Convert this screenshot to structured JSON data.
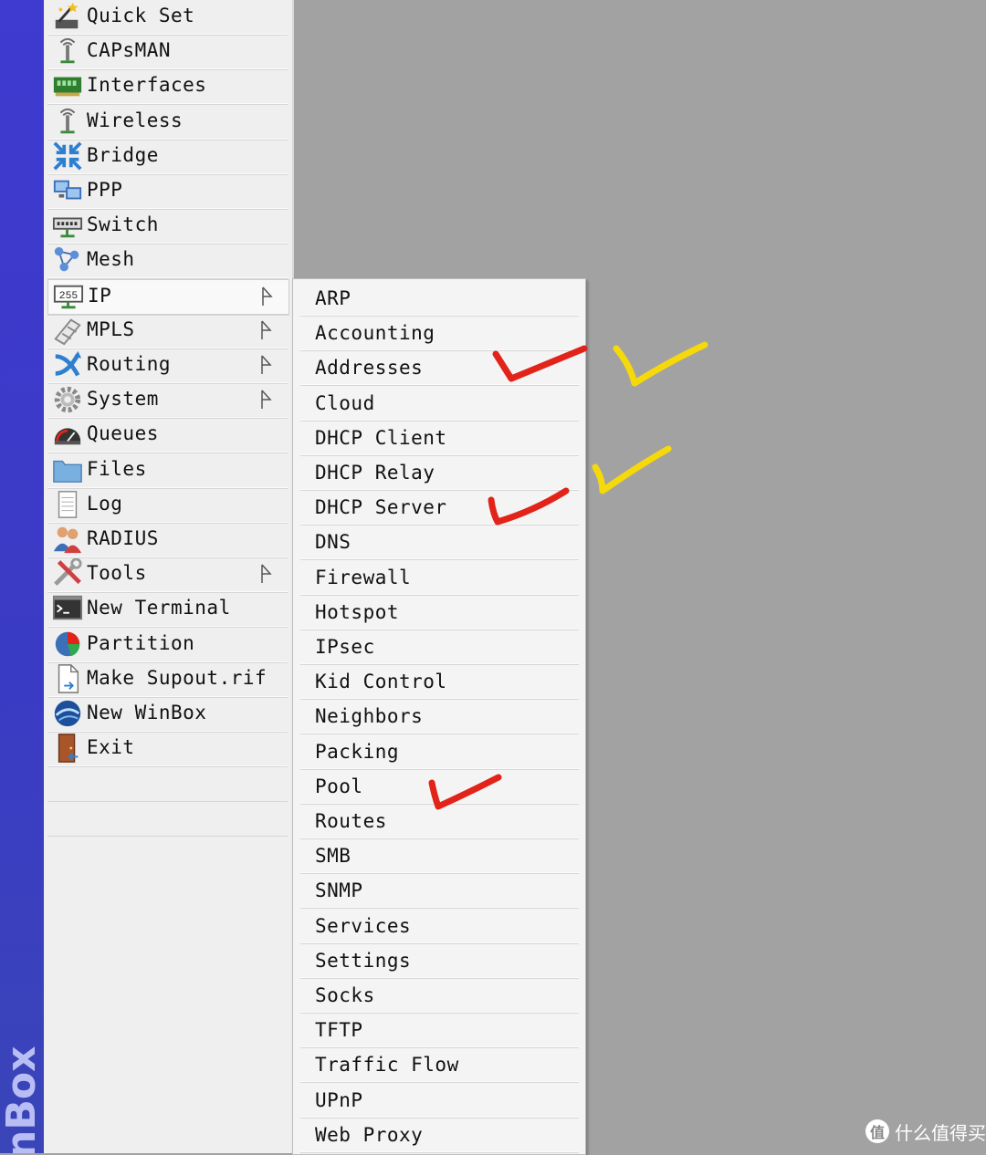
{
  "brand": {
    "text": "nBox",
    "color": "#3f3ad0"
  },
  "main_menu": {
    "items": [
      {
        "label": "Quick Set",
        "icon": "wand-icon",
        "has_submenu": false
      },
      {
        "label": "CAPsMAN",
        "icon": "antenna-icon",
        "has_submenu": false
      },
      {
        "label": "Interfaces",
        "icon": "network-card-icon",
        "has_submenu": false
      },
      {
        "label": "Wireless",
        "icon": "antenna-icon",
        "has_submenu": false
      },
      {
        "label": "Bridge",
        "icon": "bridge-icon",
        "has_submenu": false
      },
      {
        "label": "PPP",
        "icon": "computers-icon",
        "has_submenu": false
      },
      {
        "label": "Switch",
        "icon": "switch-icon",
        "has_submenu": false
      },
      {
        "label": "Mesh",
        "icon": "mesh-icon",
        "has_submenu": false
      },
      {
        "label": "IP",
        "icon": "ip-255-icon",
        "has_submenu": true,
        "active": true
      },
      {
        "label": "MPLS",
        "icon": "mpls-icon",
        "has_submenu": true
      },
      {
        "label": "Routing",
        "icon": "routing-icon",
        "has_submenu": true
      },
      {
        "label": "System",
        "icon": "gear-icon",
        "has_submenu": true
      },
      {
        "label": "Queues",
        "icon": "gauge-icon",
        "has_submenu": false
      },
      {
        "label": "Files",
        "icon": "folder-icon",
        "has_submenu": false
      },
      {
        "label": "Log",
        "icon": "notepad-icon",
        "has_submenu": false
      },
      {
        "label": "RADIUS",
        "icon": "users-icon",
        "has_submenu": false
      },
      {
        "label": "Tools",
        "icon": "tools-icon",
        "has_submenu": true
      },
      {
        "label": "New Terminal",
        "icon": "terminal-icon",
        "has_submenu": false
      },
      {
        "label": "Partition",
        "icon": "pie-chart-icon",
        "has_submenu": false
      },
      {
        "label": "Make Supout.rif",
        "icon": "document-icon",
        "has_submenu": false
      },
      {
        "label": "New WinBox",
        "icon": "winbox-globe-icon",
        "has_submenu": false
      },
      {
        "label": "Exit",
        "icon": "door-exit-icon",
        "has_submenu": false
      }
    ]
  },
  "ip_submenu": {
    "items": [
      "ARP",
      "Accounting",
      "Addresses",
      "Cloud",
      "DHCP Client",
      "DHCP Relay",
      "DHCP Server",
      "DNS",
      "Firewall",
      "Hotspot",
      "IPsec",
      "Kid Control",
      "Neighbors",
      "Packing",
      "Pool",
      "Routes",
      "SMB",
      "SNMP",
      "Services",
      "Settings",
      "Socks",
      "TFTP",
      "Traffic Flow",
      "UPnP",
      "Web Proxy"
    ]
  },
  "annotations": {
    "red_check_color": "#e2231a",
    "yellow_check_color": "#f5d90a",
    "red_checked_items": [
      "Addresses",
      "DHCP Server",
      "Pool"
    ],
    "yellow_checked_items": [
      "Addresses",
      "DHCP Relay"
    ]
  },
  "watermark": {
    "logo": "值",
    "text": "什么值得买"
  }
}
